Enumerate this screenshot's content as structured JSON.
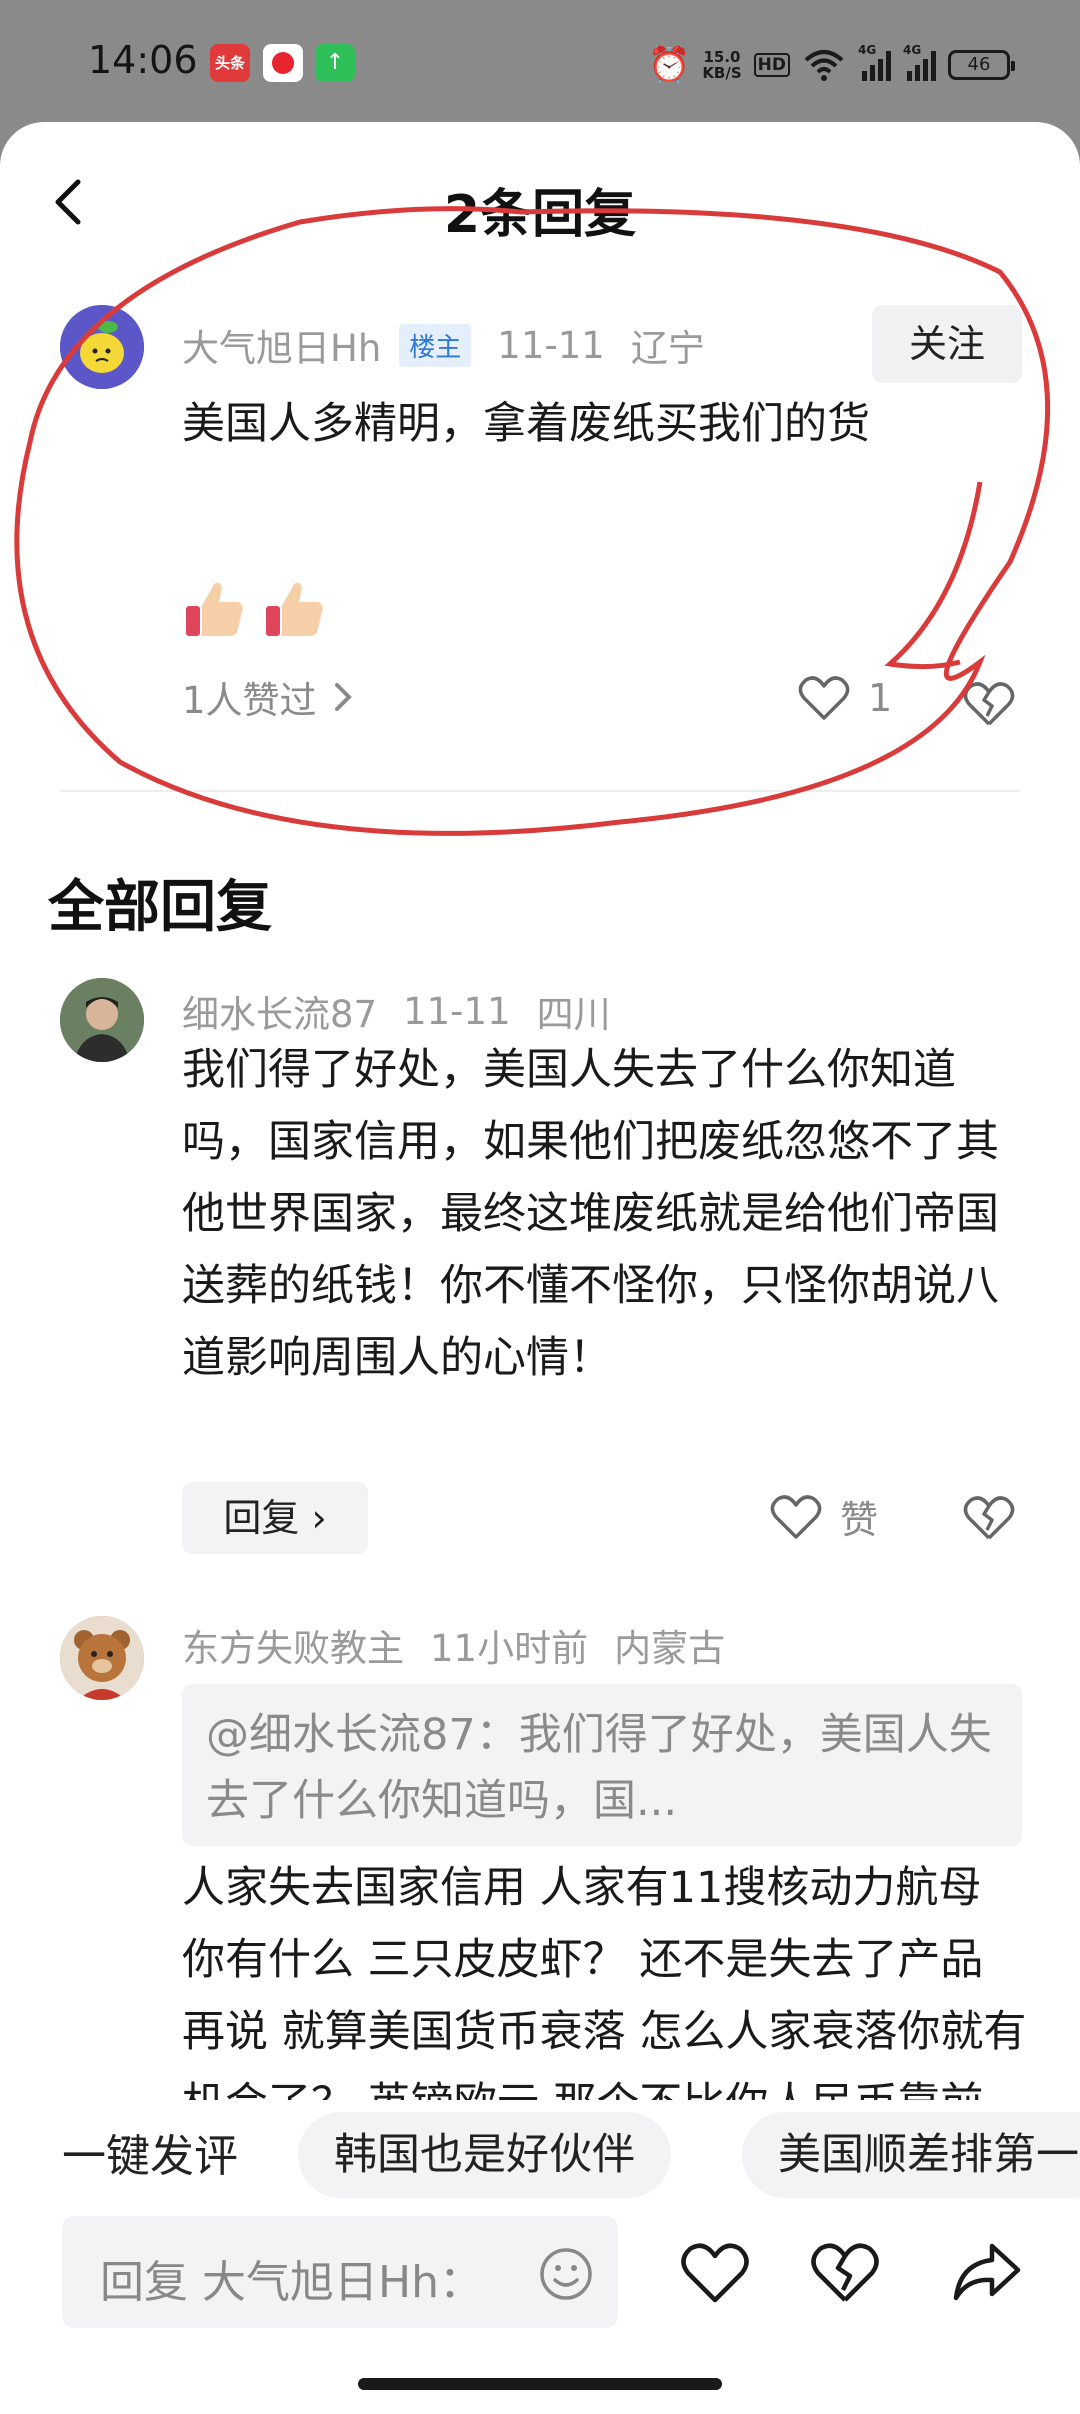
{
  "status_bar": {
    "time": "14:06",
    "app_badge_1": "头条",
    "net_speed_value": "15.0",
    "net_speed_unit": "KB/S",
    "hd_label": "HD",
    "signal_1_label": "4G",
    "signal_2_label": "4G",
    "battery": "46"
  },
  "header": {
    "title": "2条回复"
  },
  "main_comment": {
    "author": "大气旭日Hh",
    "badge": "楼主",
    "date": "11-11",
    "location": "辽宁",
    "follow_label": "关注",
    "text": "美国人多精明，拿着废纸买我们的货",
    "likes_summary": "1人赞过",
    "like_count": "1"
  },
  "section_title": "全部回复",
  "replies": [
    {
      "author": "细水长流87",
      "date": "11-11",
      "location": "四川",
      "text": "我们得了好处，美国人失去了什么你知道吗，国家信用，如果他们把废纸忽悠不了其他世界国家，最终这堆废纸就是给他们帝国送葬的纸钱！你不懂不怪你，只怪你胡说八道影响周围人的心情！",
      "reply_label": "回复",
      "like_label": "赞"
    },
    {
      "author": "东方失败教主",
      "date": "11小时前",
      "location": "内蒙古",
      "quote": "@细水长流87：我们得了好处，美国人失去了什么你知道吗，国...",
      "text": "人家失去国家信用 人家有11搜核动力航母 你有什么 三只皮皮虾？ 还不是失去了产品 再说 就算美国货币衰落 怎么人家衰落你就有机会了？ 英镑欧元 那个不比你人民币靠前 班里成绩第一 转学"
    }
  ],
  "suggestions": {
    "label": "一键发评",
    "chips": [
      "韩国也是好伙伴",
      "美国顺差排第一"
    ]
  },
  "input": {
    "placeholder": "回复 大气旭日Hh："
  },
  "colors": {
    "annotation_red": "#d93b3b",
    "op_badge_blue": "#2f78d6",
    "muted_text": "#9a9a9a"
  },
  "icons": [
    "back-icon",
    "heart-icon",
    "broken-heart-icon",
    "emoji-icon",
    "share-icon",
    "chevron-right-icon",
    "thumbs-up-emoji"
  ]
}
